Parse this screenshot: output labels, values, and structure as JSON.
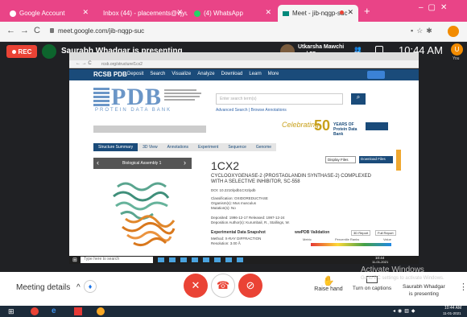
{
  "tabs": [
    {
      "label": "Google Account",
      "icon": "google-icon"
    },
    {
      "label": "Inbox (44) - placements@vjyups",
      "icon": "gmail-icon"
    },
    {
      "label": "(4) WhatsApp",
      "icon": "whatsapp-icon"
    },
    {
      "label": "Meet - jib-nqgp-suc",
      "icon": "meet-icon"
    }
  ],
  "url": "meet.google.com/jib-nqgp-suc",
  "meet": {
    "rec": "REC",
    "presenter": "Saurabh Whadgar is presenting",
    "participants": "Utkarsha Mawchi\nand 55 more",
    "participant_count": "57",
    "time": "10:44 AM",
    "you": "You",
    "avatar_initial": "U"
  },
  "inner_browser": {
    "url": "rcsb.org/structure/1cx2",
    "logo": "RCSB PDB",
    "nav": [
      "Deposit",
      "Search",
      "Visualize",
      "Analyze",
      "Download",
      "Learn",
      "More"
    ],
    "tagline": "PROTEIN DATA BANK",
    "pdb": "PDB",
    "search_placeholder": "Enter search term(s)",
    "advanced": "Advanced Search | Browse Annotations",
    "celebrating": "Celebrating",
    "years": "50",
    "years_text": "YEARS OF Protein Data Bank",
    "tabs": [
      "Structure Summary",
      "3D View",
      "Annotations",
      "Experiment",
      "Sequence",
      "Genome"
    ],
    "assembly": "Biological Assembly 1",
    "entry_id": "1CX2",
    "title": "CYCLOOXYGENASE-2 (PROSTAGLANDIN SYNTHASE-2) COMPLEXED WITH A SELECTIVE INHIBITOR, SC-558",
    "display_files": "Display Files",
    "download_files": "Download Files",
    "doi": "DOI: 10.2210/pdb1CX2/pdb",
    "classification": "Classification: OXIDOREDUCTASE",
    "organism": "Organism(s): Mus musculus",
    "mutation": "Mutation(s): No",
    "deposited": "Deposited: 1996-12-17 Released: 1997-12-24",
    "authors": "Deposition Author(s): Kurumbail, R., Stallings, W.",
    "exp_title": "Experimental Data Snapshot",
    "method": "Method: X-RAY DIFFRACTION",
    "resolution": "Resolution: 3.00 Å",
    "validation_title": "wwPDB Validation",
    "report1": "3D Report",
    "report2": "Full Report",
    "metric": "Metric",
    "percentile": "Percentile Ranks",
    "value": "Value"
  },
  "inner_taskbar": {
    "search": "Type here to search",
    "time": "10:44",
    "date": "11-01-2021"
  },
  "controls": {
    "meeting_details": "Meeting details",
    "raise_hand": "Raise hand",
    "captions": "Turn on captions",
    "presenter": "Saurabh Whadgar\nis presenting"
  },
  "watermark": {
    "line1": "Activate Windows",
    "line2": "Go to PC settings to activate Windows."
  },
  "taskbar": {
    "time": "10:44 AM",
    "date": "11-01-2021"
  },
  "colors": {
    "tabbar": "#e94487",
    "meet_bg": "#202124",
    "red": "#ea4335",
    "rcsb_blue": "#1a4b7a"
  }
}
